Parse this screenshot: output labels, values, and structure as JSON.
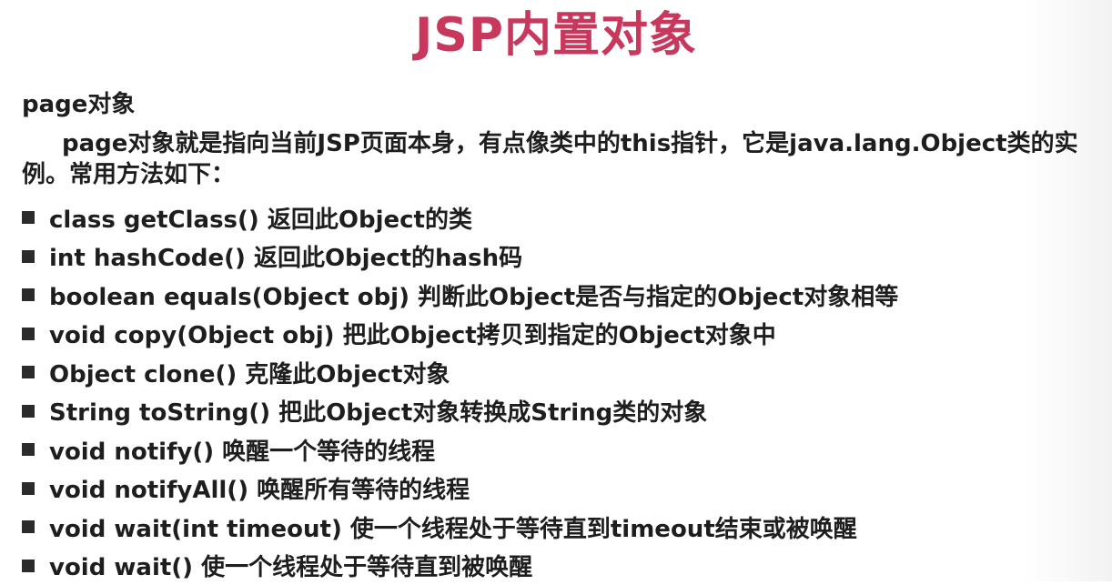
{
  "slide": {
    "title": "JSP内置对象",
    "heading": "page对象",
    "intro": "page对象就是指向当前JSP页面本身，有点像类中的this指针，它是java.lang.Object类的实例。常用方法如下：",
    "methods": [
      "class getClass() 返回此Object的类",
      "int hashCode() 返回此Object的hash码",
      "boolean equals(Object obj) 判断此Object是否与指定的Object对象相等",
      "void copy(Object obj) 把此Object拷贝到指定的Object对象中",
      "Object clone() 克隆此Object对象",
      "String toString() 把此Object对象转换成String类的对象",
      "void notify() 唤醒一个等待的线程",
      "void notifyAll() 唤醒所有等待的线程",
      "void wait(int timeout) 使一个线程处于等待直到timeout结束或被唤醒",
      "void wait() 使一个线程处于等待直到被唤醒"
    ]
  },
  "colors": {
    "title": "#c8385d",
    "text": "#1e1e1e",
    "bullet": "#2b2b2b"
  }
}
